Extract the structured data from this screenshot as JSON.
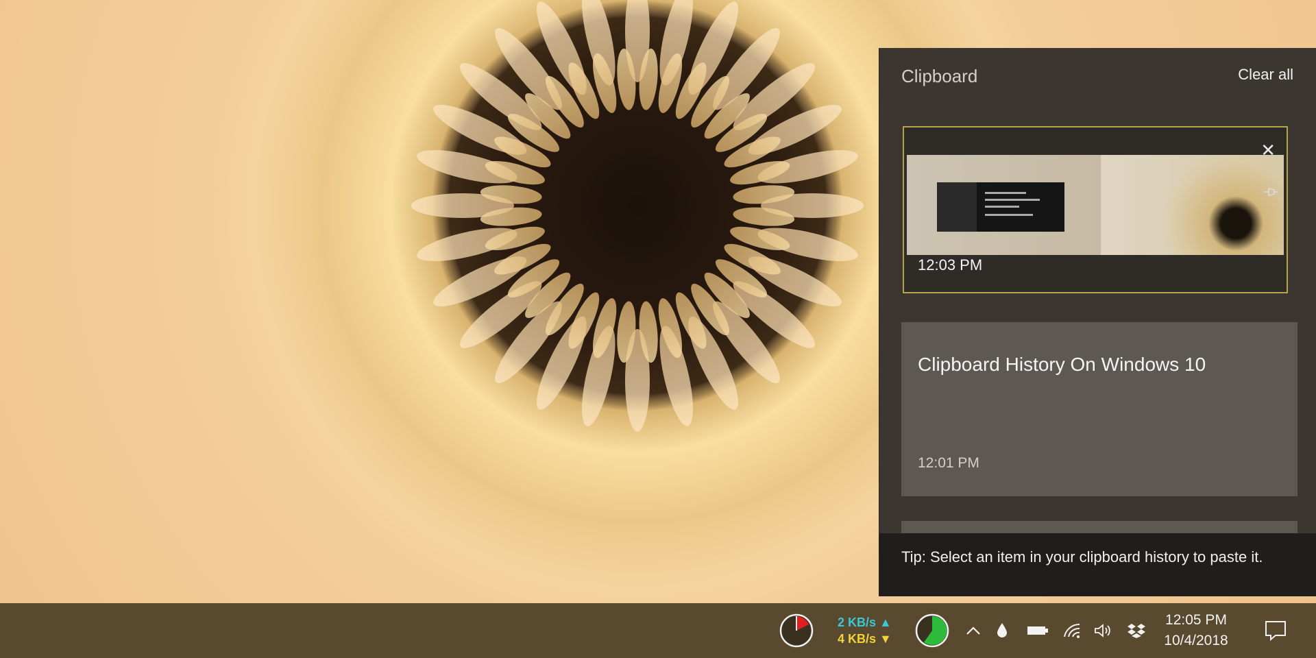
{
  "clipboard": {
    "title": "Clipboard",
    "clear_all_label": "Clear all",
    "items": [
      {
        "type": "image",
        "time": "12:03 PM"
      },
      {
        "type": "text",
        "text": "Clipboard History On Windows 10",
        "time": "12:01 PM"
      }
    ],
    "tip": "Tip: Select an item in your clipboard history to paste it."
  },
  "taskbar": {
    "network": {
      "upload": "2 KB/s",
      "download": "4 KB/s"
    },
    "clock": {
      "time": "12:05 PM",
      "date": "10/4/2018"
    }
  },
  "icons": {
    "card_close": "close-icon",
    "card_pin": "pin-icon",
    "upload_arrow": "arrow-up-icon",
    "download_arrow": "arrow-down-icon",
    "tray_expand": "chevron-up-icon",
    "droplet": "droplet-icon",
    "battery": "battery-icon",
    "wifi": "wifi-icon",
    "volume": "volume-icon",
    "dropbox": "dropbox-icon",
    "action_center": "action-center-icon"
  },
  "colors": {
    "selection_border": "#b9a24e",
    "upload_text": "#39c9d6",
    "download_text": "#f2d33a",
    "memory_fill": "#2dbb3c",
    "cpu_fill": "#e02020"
  }
}
